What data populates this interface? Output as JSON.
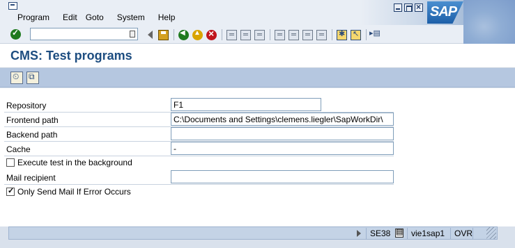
{
  "menu": {
    "items": [
      "Program",
      "Edit",
      "Goto",
      "System",
      "Help"
    ]
  },
  "logo": {
    "text": "SAP"
  },
  "toolbar": {
    "command_value": ""
  },
  "title": "CMS: Test programs",
  "form": {
    "repository": {
      "label": "Repository",
      "value": "F1"
    },
    "frontend_path": {
      "label": "Frontend path",
      "value": "C:\\Documents and Settings\\clemens.liegler\\SapWorkDir\\"
    },
    "backend_path": {
      "label": "Backend path",
      "value": ""
    },
    "cache": {
      "label": "Cache",
      "value": "-"
    },
    "execute_background": {
      "label": "Execute test in the background",
      "checked": false
    },
    "mail_recipient": {
      "label": "Mail recipient",
      "value": ""
    },
    "only_send_mail": {
      "label": "Only Send Mail If Error Occurs",
      "checked": true
    }
  },
  "status": {
    "transaction": "SE38",
    "server": "vie1sap1",
    "mode": "OVR"
  },
  "colors": {
    "title": "#1d4d80",
    "app_toolbar": "#b5c7e0",
    "menubar": "#e9eef5"
  }
}
